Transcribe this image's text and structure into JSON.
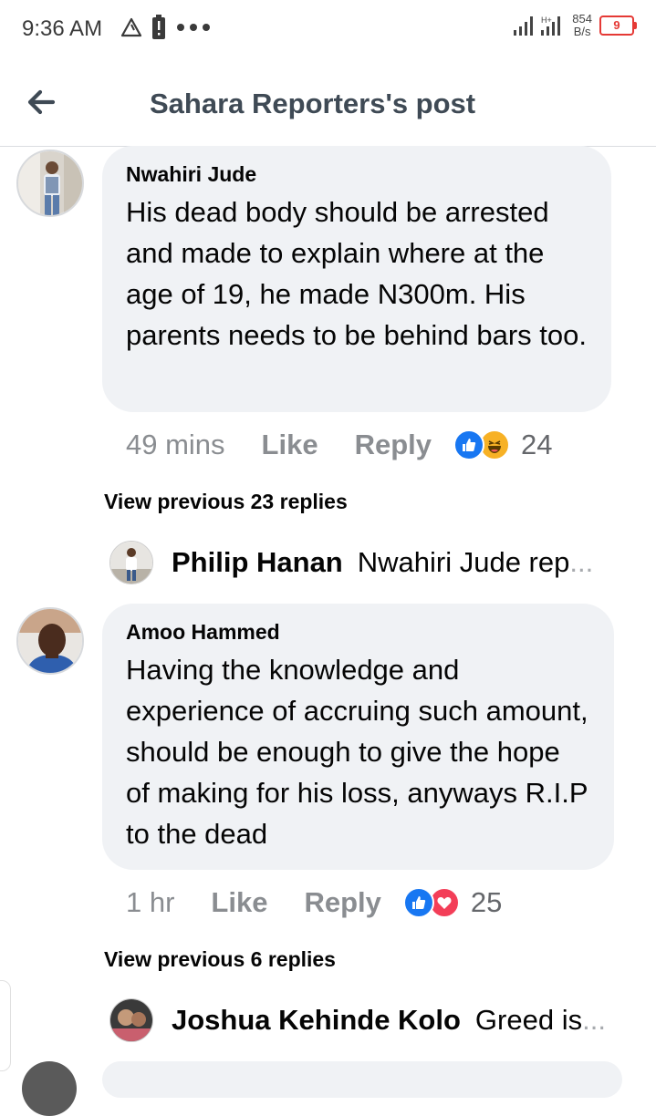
{
  "status_bar": {
    "time": "9:36 AM",
    "icons": [
      "warning-triangle-icon",
      "battery-saver-icon",
      "more-dots-icon"
    ],
    "network_speed_value": "854",
    "network_speed_unit": "B/s",
    "battery": "9"
  },
  "header": {
    "back_icon": "back-arrow-icon",
    "title": "Sahara Reporters's post"
  },
  "comments": [
    {
      "author": "Nwahiri Jude",
      "text": "His dead body should be arrested and made to explain where at the age of 19, he made N300m. His parents needs to be behind bars too.",
      "time": "49 mins",
      "like_label": "Like",
      "reply_label": "Reply",
      "reactions": [
        "like",
        "haha"
      ],
      "reaction_count": "24",
      "view_previous": "View previous 23 replies",
      "latest_reply": {
        "author": "Philip Hanan",
        "text": "Nwahiri Jude rep",
        "ellipsis": "..."
      }
    },
    {
      "author": "Amoo Hammed",
      "text": "Having the knowledge and experience of accruing such amount, should be enough to give the hope of making for his loss, anyways R.I.P to the dead",
      "time": "1 hr",
      "like_label": "Like",
      "reply_label": "Reply",
      "reactions": [
        "like",
        "love"
      ],
      "reaction_count": "25",
      "view_previous": "View previous 6 replies",
      "latest_reply": {
        "author": "Joshua Kehinde Kolo",
        "text": "Greed is",
        "ellipsis": "..."
      }
    }
  ],
  "colors": {
    "like_blue": "#1877f2",
    "love_red": "#f33e58",
    "haha_yellow": "#f7b125",
    "bubble_bg": "#f0f2f5",
    "muted_text": "#65676b"
  }
}
